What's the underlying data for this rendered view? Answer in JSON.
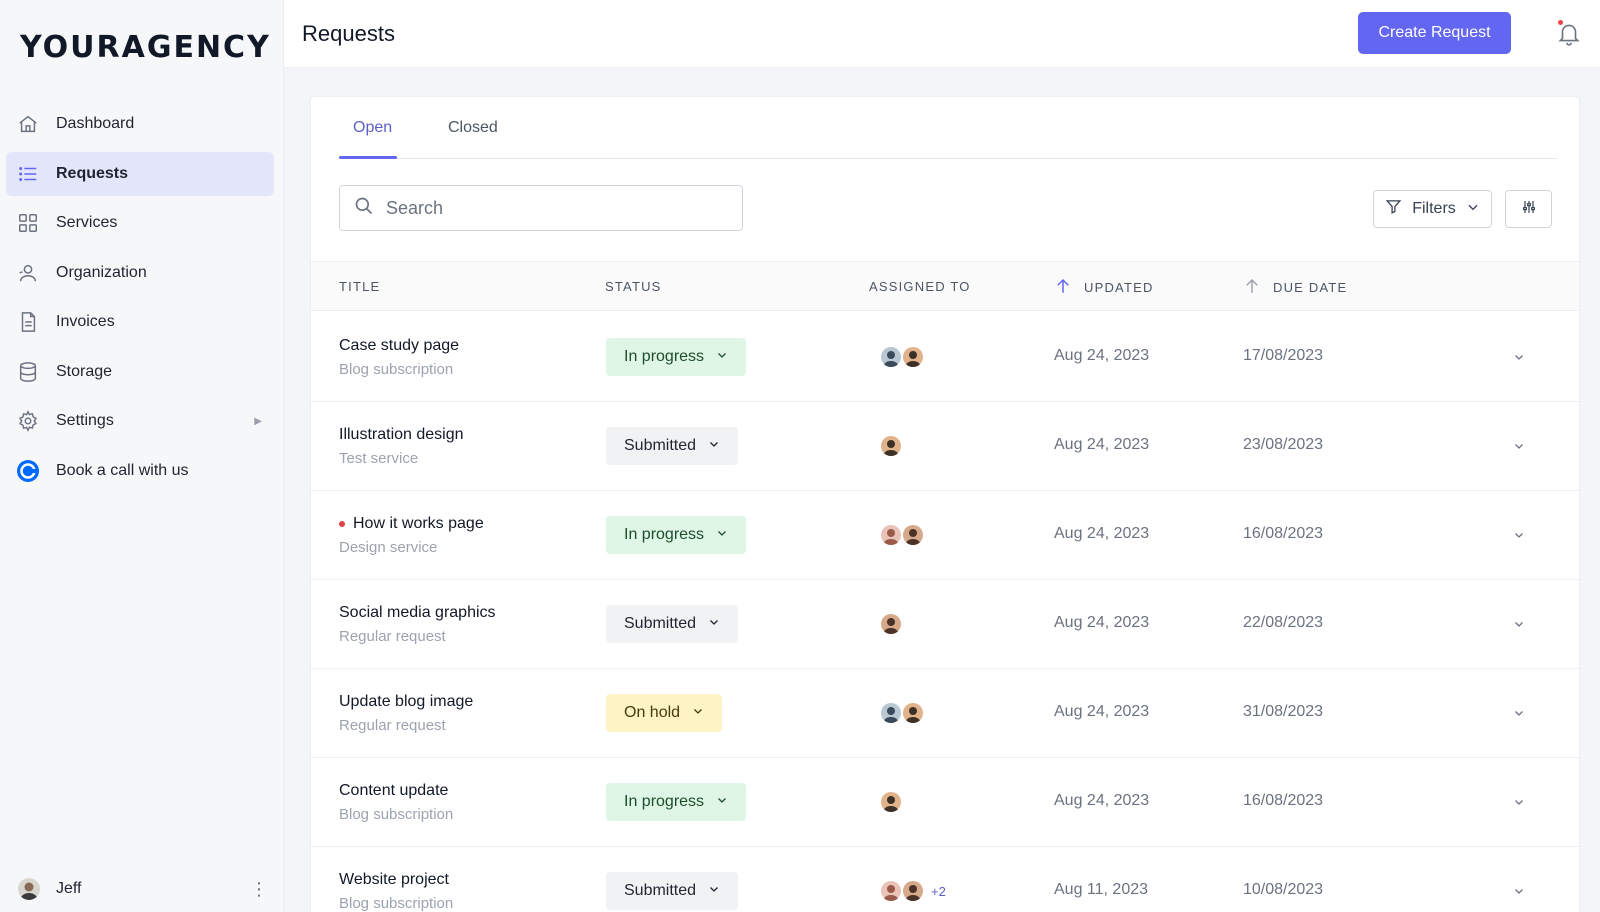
{
  "brand": {
    "logo_text": "YOURAGENCY"
  },
  "sidebar": {
    "items": [
      {
        "label": "Dashboard",
        "icon": "home-icon"
      },
      {
        "label": "Requests",
        "icon": "list-icon",
        "active": true
      },
      {
        "label": "Services",
        "icon": "grid-icon"
      },
      {
        "label": "Organization",
        "icon": "users-icon"
      },
      {
        "label": "Invoices",
        "icon": "document-icon"
      },
      {
        "label": "Storage",
        "icon": "database-icon"
      },
      {
        "label": "Settings",
        "icon": "gear-icon",
        "has_submenu": true
      },
      {
        "label": "Book a call with us",
        "icon": "call-logo-icon"
      }
    ],
    "user": {
      "name": "Jeff"
    }
  },
  "header": {
    "title": "Requests",
    "create_label": "Create Request"
  },
  "tabs": [
    {
      "label": "Open",
      "active": true
    },
    {
      "label": "Closed"
    }
  ],
  "search": {
    "placeholder": "Search"
  },
  "toolbar": {
    "filters_label": "Filters"
  },
  "table": {
    "columns": [
      "TITLE",
      "STATUS",
      "ASSIGNED TO",
      "UPDATED",
      "DUE DATE"
    ],
    "rows": [
      {
        "title": "Case study page",
        "subtitle": "Blog subscription",
        "status": "In progress",
        "status_type": "progress",
        "assignees": 2,
        "more": "",
        "updated": "Aug 24, 2023",
        "due": "17/08/2023",
        "unread": false
      },
      {
        "title": "Illustration design",
        "subtitle": "Test service",
        "status": "Submitted",
        "status_type": "submitted",
        "assignees": 1,
        "more": "",
        "updated": "Aug 24, 2023",
        "due": "23/08/2023",
        "unread": false
      },
      {
        "title": "How it works page",
        "subtitle": "Design service",
        "status": "In progress",
        "status_type": "progress",
        "assignees": 2,
        "more": "",
        "updated": "Aug 24, 2023",
        "due": "16/08/2023",
        "unread": true
      },
      {
        "title": "Social media graphics",
        "subtitle": "Regular request",
        "status": "Submitted",
        "status_type": "submitted",
        "assignees": 1,
        "more": "",
        "updated": "Aug 24, 2023",
        "due": "22/08/2023",
        "unread": false
      },
      {
        "title": "Update blog image",
        "subtitle": "Regular request",
        "status": "On hold",
        "status_type": "hold",
        "assignees": 2,
        "more": "",
        "updated": "Aug 24, 2023",
        "due": "31/08/2023",
        "unread": false
      },
      {
        "title": "Content update",
        "subtitle": "Blog subscription",
        "status": "In progress",
        "status_type": "progress",
        "assignees": 1,
        "more": "",
        "updated": "Aug 24, 2023",
        "due": "16/08/2023",
        "unread": false
      },
      {
        "title": "Website project",
        "subtitle": "Blog subscription",
        "status": "Submitted",
        "status_type": "submitted",
        "assignees": 2,
        "more": "+2",
        "updated": "Aug 11, 2023",
        "due": "10/08/2023",
        "unread": false
      }
    ]
  },
  "colors": {
    "accent": "#6366f1",
    "progress_bg": "#dff5e6",
    "submitted_bg": "#f1f2f4",
    "hold_bg": "#fdf3c4",
    "unread_dot": "#e0424a"
  }
}
